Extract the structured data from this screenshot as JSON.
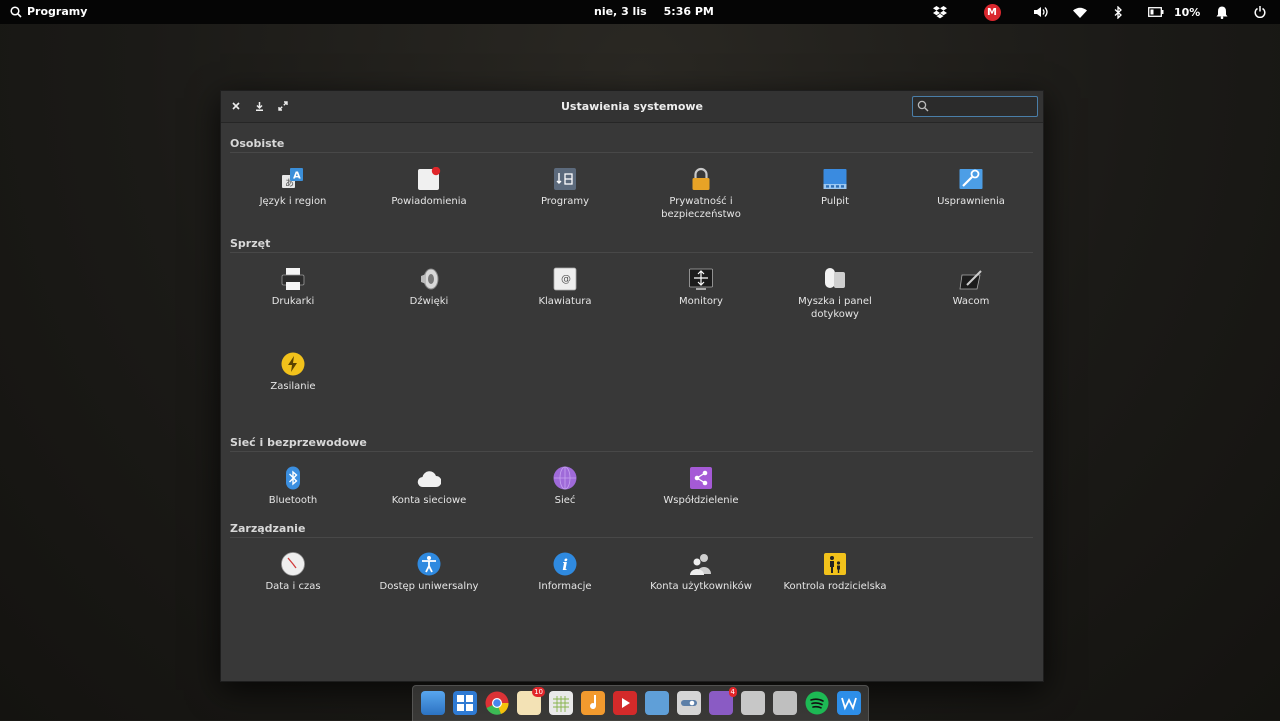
{
  "panel": {
    "apps_label": "Programy",
    "date": "nie, 3 lis",
    "time": "5:36 PM",
    "battery": "10%",
    "mega_letter": "M"
  },
  "window": {
    "title": "Ustawienia systemowe",
    "search_placeholder": ""
  },
  "sections": {
    "personal": {
      "label": "Osobiste",
      "items": [
        "Język i region",
        "Powiadomienia",
        "Programy",
        "Prywatność i bezpieczeństwo",
        "Pulpit",
        "Usprawnienia"
      ]
    },
    "hardware": {
      "label": "Sprzęt",
      "items": [
        "Drukarki",
        "Dźwięki",
        "Klawiatura",
        "Monitory",
        "Myszka i panel dotykowy",
        "Wacom",
        "Zasilanie"
      ]
    },
    "network": {
      "label": "Sieć i bezprzewodowe",
      "items": [
        "Bluetooth",
        "Konta sieciowe",
        "Sieć",
        "Współdzielenie"
      ]
    },
    "admin": {
      "label": "Zarządzanie",
      "items": [
        "Data i czas",
        "Dostęp uniwersalny",
        "Informacje",
        "Konta użytkowników",
        "Kontrola rodzicielska"
      ]
    }
  },
  "dock": {
    "badges": {
      "mail": "10",
      "tasks": "4"
    }
  },
  "colors": {
    "accent": "#4a7ea8",
    "window_bg": "#383838",
    "panel_bg": "#050505"
  }
}
